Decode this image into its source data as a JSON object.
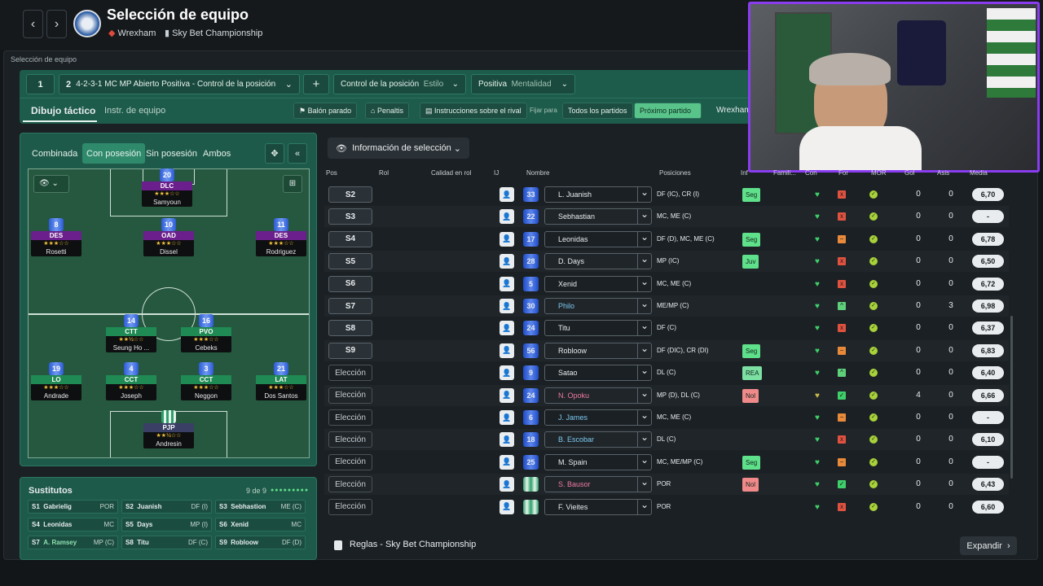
{
  "header": {
    "title": "Selección de equipo",
    "club": "Wrexham",
    "competition": "Sky Bet Championship",
    "back_icon": "‹",
    "forward_icon": "›"
  },
  "breadcrumb": "Selección de equipo",
  "tactics": {
    "slot_number": "1",
    "tactic_number": "2",
    "tactic_name": "4-2-3-1 MC MP Abierto Positiva - Control de la posición",
    "add_label": "+",
    "style_value": "Control de la posición",
    "style_label": "Estilo",
    "mentality_value": "Positiva",
    "mentality_label": "Mentalidad",
    "tab_active": "Dibujo táctico",
    "tab_other": "Instr. de equipo",
    "set_pieces": "Balón parado",
    "penalties": "Penaltis",
    "opponent_instructions": "Instrucciones sobre el rival",
    "fix_for": "Fijar para",
    "all_matches": "Todos los partidos",
    "next_match": "Próximo partido",
    "club_tab": "Wrexham"
  },
  "phase_tabs": [
    "Combinada",
    "Con posesión",
    "Sin posesión",
    "Ambos"
  ],
  "pitch_players": [
    {
      "num": "20",
      "role": "DLC",
      "name": "Samyoun",
      "stars": "★★★☆☆",
      "color": "#6a1f8c"
    },
    {
      "num": "8",
      "role": "DES",
      "name": "Rosetti",
      "stars": "★★★☆☆",
      "color": "#6a1f8c"
    },
    {
      "num": "10",
      "role": "OAD",
      "name": "Dissel",
      "stars": "★★★☆☆",
      "color": "#6a1f8c"
    },
    {
      "num": "11",
      "role": "DES",
      "name": "Rodriguez",
      "stars": "★★★☆☆",
      "color": "#6a1f8c"
    },
    {
      "num": "14",
      "role": "CTT",
      "name": "Seung Ho ...",
      "stars": "★★½☆☆",
      "color": "#1f8a54"
    },
    {
      "num": "16",
      "role": "PVO",
      "name": "Cebeks",
      "stars": "★★★☆☆",
      "color": "#1f8a54"
    },
    {
      "num": "19",
      "role": "LO",
      "name": "Andrade",
      "stars": "★★★☆☆",
      "color": "#1f8a54"
    },
    {
      "num": "4",
      "role": "CCT",
      "name": "Joseph",
      "stars": "★★★☆☆",
      "color": "#1f8a54"
    },
    {
      "num": "3",
      "role": "CCT",
      "name": "Neggon",
      "stars": "★★★☆☆",
      "color": "#1f8a54"
    },
    {
      "num": "21",
      "role": "LAT",
      "name": "Dos Santos",
      "stars": "★★★☆☆",
      "color": "#1f8a54"
    },
    {
      "num": "",
      "role": "PJP",
      "name": "Andresin",
      "stars": "★★½☆☆",
      "color": "#3a3f66"
    }
  ],
  "substitutes": {
    "title": "Sustitutos",
    "count": "9 de 9",
    "items": [
      {
        "slot": "S1",
        "name": "Gabrielig",
        "pos": "POR"
      },
      {
        "slot": "S2",
        "name": "Juanish",
        "pos": "DF (I)"
      },
      {
        "slot": "S3",
        "name": "Sebhastion",
        "pos": "ME (C)"
      },
      {
        "slot": "S4",
        "name": "Leonidas",
        "pos": "MC"
      },
      {
        "slot": "S5",
        "name": "Days",
        "pos": "MP (I)"
      },
      {
        "slot": "S6",
        "name": "Xenid",
        "pos": "MC"
      },
      {
        "slot": "S7",
        "name": "A. Ramsey",
        "pos": "MP (C)"
      },
      {
        "slot": "S8",
        "name": "Titu",
        "pos": "DF (C)"
      },
      {
        "slot": "S9",
        "name": "Robloow",
        "pos": "DF (D)"
      }
    ]
  },
  "selection_dropdown": "Información de selección",
  "table_headers": [
    "Pos",
    "Rol",
    "Calidad en rol",
    "IJ",
    "Nombre",
    "Posiciones",
    "Inf",
    "Famili...",
    "Con",
    "For",
    "MOR",
    "Gol",
    "Asis",
    "Media"
  ],
  "rows": [
    {
      "pos": "S2",
      "num": "33",
      "name": "L. Juanish",
      "positions": "DF (IC), CR (I)",
      "inf": "Seg",
      "for": "x",
      "forc": "#e0523f",
      "mor": "✓",
      "gol": "0",
      "asis": "0",
      "media": "6,70",
      "gk": false,
      "nc": "#e8ecef",
      "infc": "#5fe08a",
      "heart": "#3fd06a"
    },
    {
      "pos": "S3",
      "num": "22",
      "name": "Sebhastian",
      "positions": "MC, ME (C)",
      "inf": "",
      "for": "x",
      "forc": "#e0523f",
      "mor": "✓",
      "gol": "0",
      "asis": "0",
      "media": "-",
      "gk": false,
      "nc": "#e8ecef",
      "infc": "",
      "heart": "#3fd06a"
    },
    {
      "pos": "S4",
      "num": "17",
      "name": "Leonidas",
      "positions": "DF (D), MC, ME (C)",
      "inf": "Seg",
      "for": "−",
      "forc": "#e88a3a",
      "mor": "✓",
      "gol": "0",
      "asis": "0",
      "media": "6,78",
      "gk": false,
      "nc": "#e8ecef",
      "infc": "#5fe08a",
      "heart": "#3fd06a"
    },
    {
      "pos": "S5",
      "num": "28",
      "name": "D. Days",
      "positions": "MP (IC)",
      "inf": "Juv",
      "for": "x",
      "forc": "#e0523f",
      "mor": "✓",
      "gol": "0",
      "asis": "0",
      "media": "6,50",
      "gk": false,
      "nc": "#e8ecef",
      "infc": "#5fe08a",
      "heart": "#3fd06a"
    },
    {
      "pos": "S6",
      "num": "5",
      "name": "Xenid",
      "positions": "MC, ME (C)",
      "inf": "",
      "for": "x",
      "forc": "#e0523f",
      "mor": "✓",
      "gol": "0",
      "asis": "0",
      "media": "6,72",
      "gk": false,
      "nc": "#e8ecef",
      "infc": "",
      "heart": "#3fd06a"
    },
    {
      "pos": "S7",
      "num": "30",
      "name": "Philo",
      "positions": "ME/MP (C)",
      "inf": "",
      "for": "^",
      "forc": "#5fd07a",
      "mor": "✓",
      "gol": "0",
      "asis": "3",
      "media": "6,98",
      "gk": false,
      "nc": "#7ec8f0",
      "infc": "",
      "heart": "#3fd06a"
    },
    {
      "pos": "S8",
      "num": "24",
      "name": "Titu",
      "positions": "DF (C)",
      "inf": "",
      "for": "x",
      "forc": "#e0523f",
      "mor": "✓",
      "gol": "0",
      "asis": "0",
      "media": "6,37",
      "gk": false,
      "nc": "#e8ecef",
      "infc": "",
      "heart": "#3fd06a"
    },
    {
      "pos": "S9",
      "num": "56",
      "name": "Robloow",
      "positions": "DF (DIC), CR (DI)",
      "inf": "Seg",
      "for": "−",
      "forc": "#e88a3a",
      "mor": "✓",
      "gol": "0",
      "asis": "0",
      "media": "6,83",
      "gk": false,
      "nc": "#e8ecef",
      "infc": "#5fe08a",
      "heart": "#3fd06a"
    },
    {
      "pos": "Elección",
      "num": "9",
      "name": "Satao",
      "positions": "DL (C)",
      "inf": "REA",
      "for": "^",
      "forc": "#5fd07a",
      "mor": "✓",
      "gol": "0",
      "asis": "0",
      "media": "6,40",
      "gk": false,
      "nc": "#e8ecef",
      "infc": "#7de0a3",
      "heart": "#3fd06a"
    },
    {
      "pos": "Elección",
      "num": "24",
      "name": "N. Opoku",
      "positions": "MP (D), DL (C)",
      "inf": "Nol",
      "for": "✓",
      "forc": "#3fcf6a",
      "mor": "✓",
      "gol": "4",
      "asis": "0",
      "media": "6,66",
      "gk": false,
      "nc": "#f07aa0",
      "infc": "#f08a8a",
      "heart": "#c8b84a"
    },
    {
      "pos": "Elección",
      "num": "6",
      "name": "J. James",
      "positions": "MC, ME (C)",
      "inf": "",
      "for": "−",
      "forc": "#e88a3a",
      "mor": "✓",
      "gol": "0",
      "asis": "0",
      "media": "-",
      "gk": false,
      "nc": "#7ec8f0",
      "infc": "",
      "heart": "#3fd06a"
    },
    {
      "pos": "Elección",
      "num": "18",
      "name": "B. Escobar",
      "positions": "DL (C)",
      "inf": "",
      "for": "x",
      "forc": "#e0523f",
      "mor": "✓",
      "gol": "0",
      "asis": "0",
      "media": "6,10",
      "gk": false,
      "nc": "#7ec8f0",
      "infc": "",
      "heart": "#3fd06a"
    },
    {
      "pos": "Elección",
      "num": "25",
      "name": "M. Spain",
      "positions": "MC, ME/MP (C)",
      "inf": "Seg",
      "for": "−",
      "forc": "#e88a3a",
      "mor": "✓",
      "gol": "0",
      "asis": "0",
      "media": "-",
      "gk": false,
      "nc": "#e8ecef",
      "infc": "#5fe08a",
      "heart": "#3fd06a"
    },
    {
      "pos": "Elección",
      "num": "",
      "name": "S. Bausor",
      "positions": "POR",
      "inf": "Nol",
      "for": "✓",
      "forc": "#3fcf6a",
      "mor": "✓",
      "gol": "0",
      "asis": "0",
      "media": "6,43",
      "gk": true,
      "nc": "#f07aa0",
      "infc": "#f08a8a",
      "heart": "#3fd06a"
    },
    {
      "pos": "Elección",
      "num": "",
      "name": "F. Vieites",
      "positions": "POR",
      "inf": "",
      "for": "x",
      "forc": "#e0523f",
      "mor": "✓",
      "gol": "0",
      "asis": "0",
      "media": "6,60",
      "gk": true,
      "nc": "#e8ecef",
      "infc": "",
      "heart": "#3fd06a"
    }
  ],
  "footer": {
    "rules": "Reglas - Sky Bet Championship",
    "expand": "Expandir"
  },
  "colors": {
    "accent_green": "#1d5b4a",
    "webcam_border": "#8a3cf0"
  }
}
